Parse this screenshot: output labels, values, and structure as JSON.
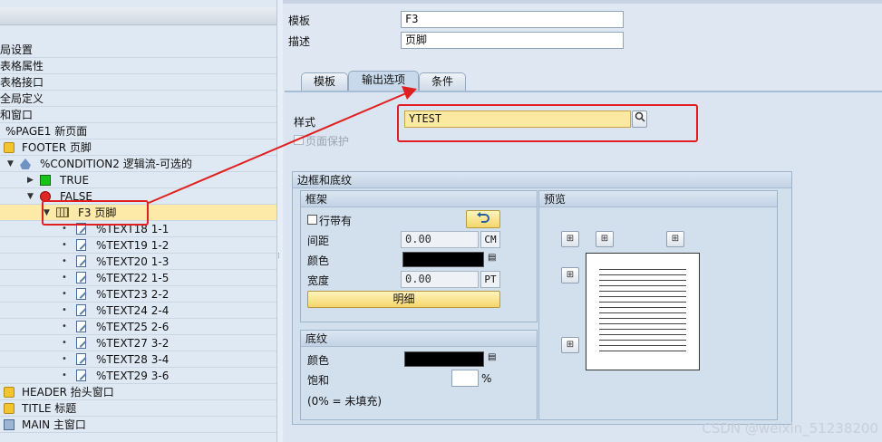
{
  "tree": {
    "rows": [
      {
        "text": "局设置"
      },
      {
        "text": "表格属性"
      },
      {
        "text": "表格接口"
      },
      {
        "text": "全局定义"
      },
      {
        "text": "和窗口"
      },
      {
        "text": "%PAGE1 新页面"
      },
      {
        "text": "FOOTER 页脚"
      },
      {
        "text": "%CONDITION2 逻辑流-可选的"
      },
      {
        "text": "TRUE"
      },
      {
        "text": "FALSE"
      },
      {
        "text": "F3 页脚"
      },
      {
        "text": "%TEXT18 1-1"
      },
      {
        "text": "%TEXT19 1-2"
      },
      {
        "text": "%TEXT20 1-3"
      },
      {
        "text": "%TEXT22 1-5"
      },
      {
        "text": "%TEXT23 2-2"
      },
      {
        "text": "%TEXT24 2-4"
      },
      {
        "text": "%TEXT25 2-6"
      },
      {
        "text": "%TEXT27 3-2"
      },
      {
        "text": "%TEXT28 3-4"
      },
      {
        "text": "%TEXT29 3-6"
      },
      {
        "text": "HEADER 抬头窗口"
      },
      {
        "text": "TITLE 标题"
      },
      {
        "text": "MAIN 主窗口"
      }
    ]
  },
  "header": {
    "template_label": "模板",
    "template_value": "F3",
    "desc_label": "描述",
    "desc_value": "页脚"
  },
  "tabs": [
    {
      "label": "模板"
    },
    {
      "label": "输出选项"
    },
    {
      "label": "条件"
    }
  ],
  "output": {
    "style_label": "样式",
    "style_value": "YTEST",
    "page_protect_label": "页面保护"
  },
  "borders": {
    "title": "边框和底纹",
    "frame": {
      "title": "框架",
      "with_line_label": "行带有",
      "spacing_label": "间距",
      "spacing_value": "0.00",
      "spacing_unit": "CM",
      "color_label": "颜色",
      "width_label": "宽度",
      "width_value": "0.00",
      "width_unit": "PT",
      "detail_button": "明细"
    },
    "shading": {
      "title": "底纹",
      "color_label": "颜色",
      "saturation_label": "饱和",
      "saturation_unit": "%",
      "note": "(0% = 未填充)"
    },
    "preview": {
      "title": "预览"
    }
  },
  "colors": {
    "accent": "#f5d66b",
    "selection": "#fde9a8",
    "annotation": "#e02020"
  },
  "watermark": "CSDN @weixin_51238200"
}
